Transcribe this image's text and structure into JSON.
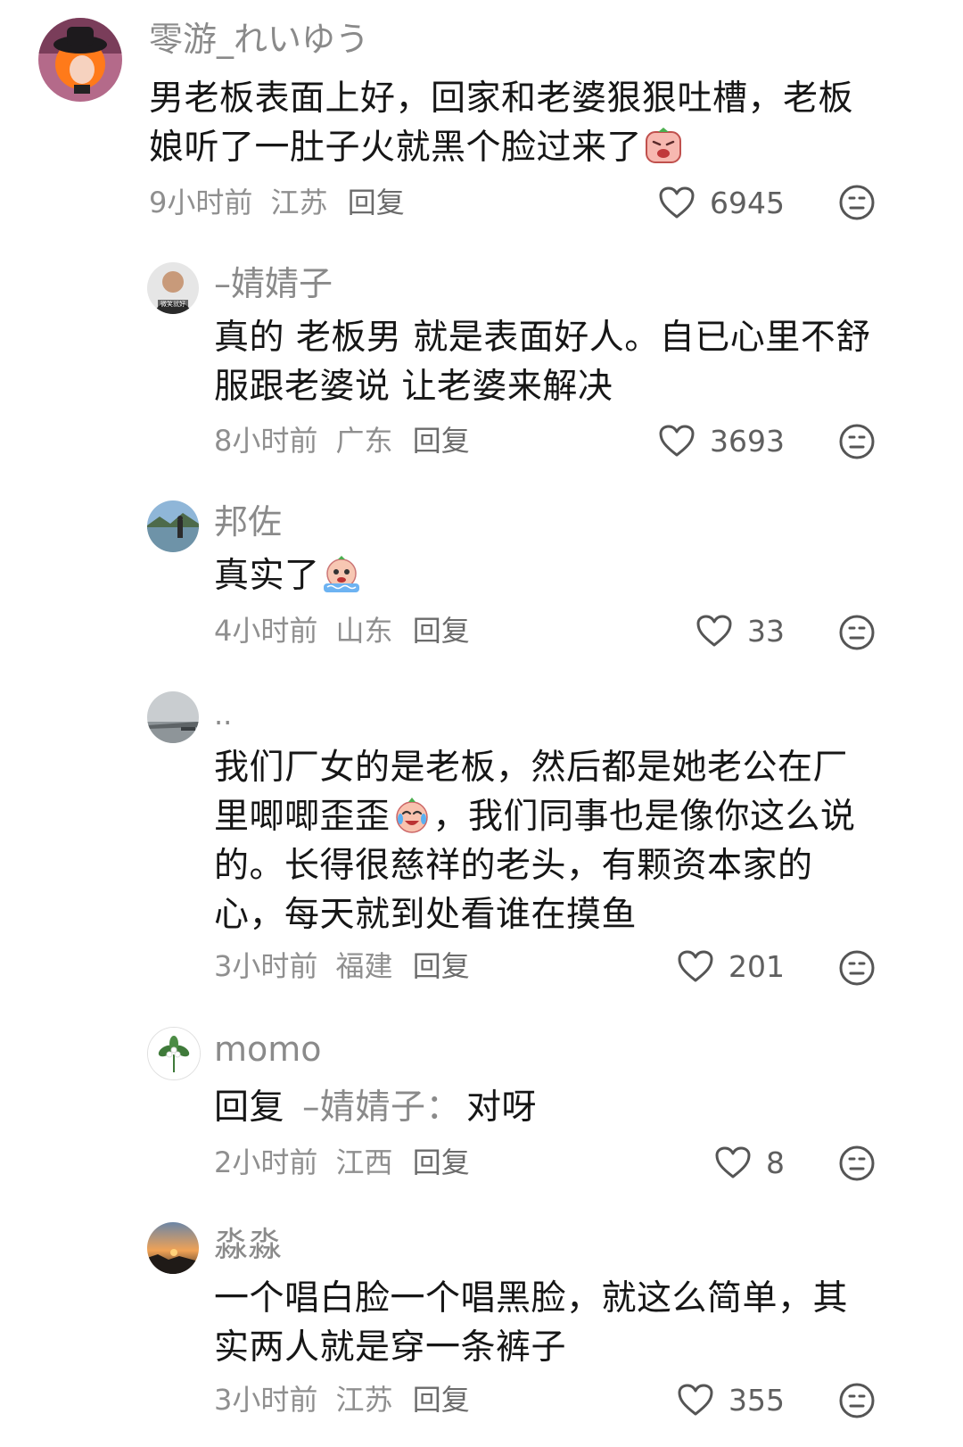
{
  "comments": [
    {
      "username": "零游_れいゆう",
      "segments": [
        "男老板表面上好，回家和老婆狠狠吐槽，老板",
        "娘听了一肚子火就黑个脸过来了"
      ],
      "time": "9小时前",
      "location": "江苏",
      "reply_label": "回复",
      "likes": "6945",
      "emoji": "angry-face-emoji"
    },
    {
      "username": "–婧婧子",
      "segments": [
        "真的 老板男 就是表面好人。自已心里不舒",
        "服跟老婆说 让老婆来解决"
      ],
      "time": "8小时前",
      "location": "广东",
      "reply_label": "回复",
      "likes": "3693",
      "avatar_badge": "微笑就好"
    },
    {
      "username": "邦佐",
      "segments": [
        "真实了"
      ],
      "time": "4小时前",
      "location": "山东",
      "reply_label": "回复",
      "likes": "33",
      "emoji": "crying-face-emoji"
    },
    {
      "username": "..",
      "segments": [
        "我们厂女的是老板，然后都是她老公在厂",
        "里唧唧歪歪",
        "，我们同事也是像你这么说",
        "的。长得很慈祥的老头，有颗资本家的",
        "心，每天就到处看谁在摸鱼"
      ],
      "time": "3小时前",
      "location": "福建",
      "reply_label": "回复",
      "likes": "201",
      "emoji": "laugh-cry-emoji"
    },
    {
      "username": "momo",
      "reply_prefix": "回复",
      "reply_target": "–婧婧子：",
      "segments": [
        "对呀"
      ],
      "time": "2小时前",
      "location": "江西",
      "reply_label": "回复",
      "likes": "8"
    },
    {
      "username": "淼淼",
      "segments": [
        "一个唱白脸一个唱黑脸，就这么简单，其",
        "实两人就是穿一条裤子"
      ],
      "time": "3小时前",
      "location": "江苏",
      "reply_label": "回复",
      "likes": "355"
    }
  ],
  "icons": {
    "like": "heart-outline-icon",
    "dislike": "meh-face-icon"
  },
  "colors": {
    "text": "#161616",
    "secondary": "#8a8a8a",
    "icon": "#555555"
  }
}
